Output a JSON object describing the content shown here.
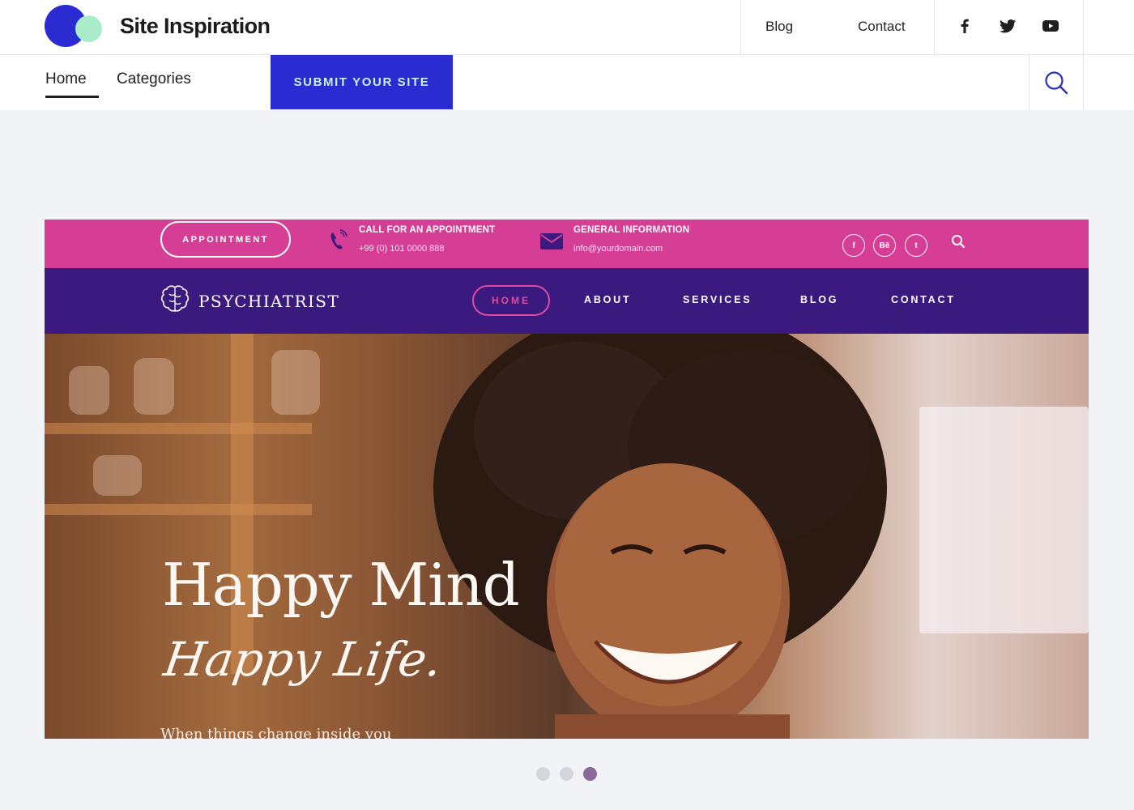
{
  "header": {
    "brand": "Site Inspiration",
    "links": [
      {
        "label": "Blog"
      },
      {
        "label": "Contact"
      }
    ],
    "social_icons": [
      "facebook-icon",
      "twitter-icon",
      "youtube-icon"
    ]
  },
  "subnav": {
    "items": [
      {
        "label": "Home",
        "active": true
      },
      {
        "label": "Categories",
        "active": false
      }
    ],
    "submit_label": "SUBMIT YOUR SITE",
    "search_icon": "search-icon"
  },
  "colors": {
    "accent": "#2a2bd1",
    "accent_mint": "#a9ecc9",
    "preview_pink": "#d63e96",
    "preview_purple": "#3b1a7f"
  },
  "preview": {
    "top_bar": {
      "appointment_button": "APPOINTMENT",
      "call_title": "CALL FOR AN APPOINTMENT",
      "call_number": "+99 (0) 101 0000 888",
      "info_title": "GENERAL INFORMATION",
      "info_email": "info@yourdomain.com",
      "social": [
        "f",
        "Bē",
        "t"
      ]
    },
    "nav": {
      "logo_text": "PSYCHIATRIST",
      "items": [
        {
          "label": "HOME",
          "active": true
        },
        {
          "label": "ABOUT"
        },
        {
          "label": "SERVICES"
        },
        {
          "label": "BLOG"
        },
        {
          "label": "CONTACT"
        }
      ]
    },
    "hero": {
      "title_line1": "Happy Mind",
      "title_line2": "Happy Life.",
      "tagline": "When things change inside you"
    }
  },
  "carousel": {
    "slide_count": 3,
    "active_index": 2
  }
}
